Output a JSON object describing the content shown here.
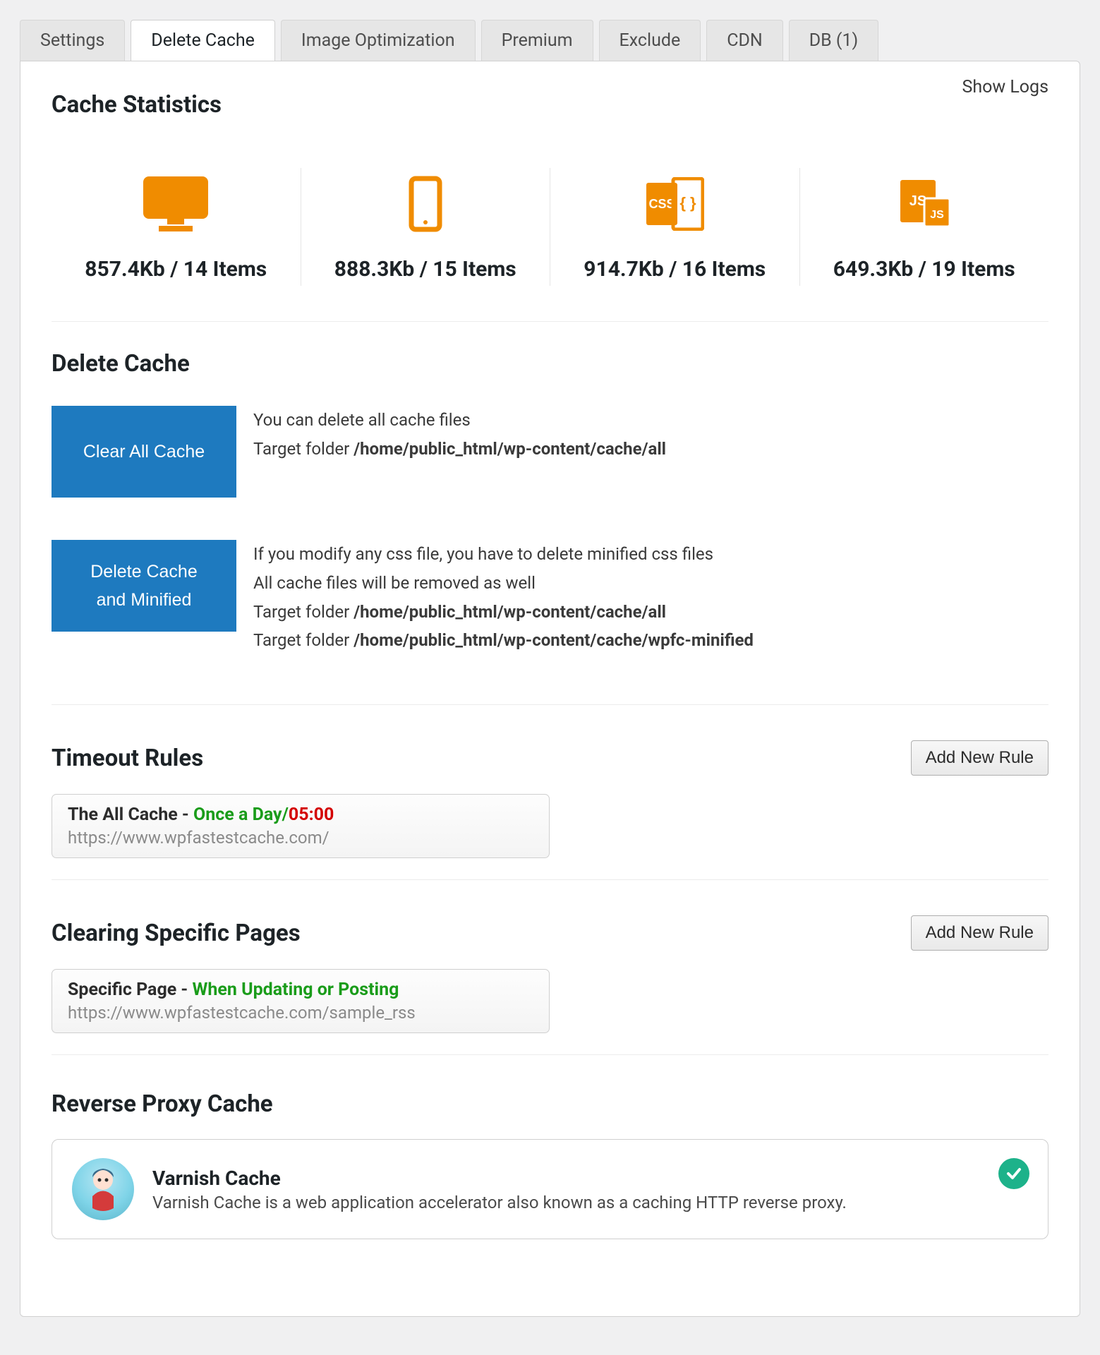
{
  "tabs": [
    {
      "label": "Settings"
    },
    {
      "label": "Delete Cache"
    },
    {
      "label": "Image Optimization"
    },
    {
      "label": "Premium"
    },
    {
      "label": "Exclude"
    },
    {
      "label": "CDN"
    },
    {
      "label": "DB (1)"
    }
  ],
  "active_tab_index": 1,
  "show_logs_label": "Show Logs",
  "sections": {
    "cache_stats_title": "Cache Statistics",
    "delete_cache_title": "Delete Cache",
    "timeout_rules_title": "Timeout Rules",
    "clearing_pages_title": "Clearing Specific Pages",
    "reverse_proxy_title": "Reverse Proxy Cache"
  },
  "stats": [
    {
      "icon": "desktop-icon",
      "value": "857.4Kb / 14 Items"
    },
    {
      "icon": "mobile-icon",
      "value": "888.3Kb / 15 Items"
    },
    {
      "icon": "css-icon",
      "value": "914.7Kb / 16 Items"
    },
    {
      "icon": "js-icon",
      "value": "649.3Kb / 19 Items"
    }
  ],
  "buttons": {
    "clear_all": "Clear All Cache",
    "delete_minified_l1": "Delete Cache",
    "delete_minified_l2": "and Minified",
    "add_new_rule": "Add New Rule"
  },
  "clear_all_desc": {
    "line1": "You can delete all cache files",
    "target_prefix": "Target folder ",
    "path1": "/home/public_html/wp-content/cache/all"
  },
  "delete_minified_desc": {
    "line1": "If you modify any css file, you have to delete minified css files",
    "line2": "All cache files will be removed as well",
    "target_prefix": "Target folder ",
    "path1": "/home/public_html/wp-content/cache/all",
    "path2": "/home/public_html/wp-content/cache/wpfc-minified"
  },
  "timeout_rule": {
    "pre": "The All Cache - ",
    "freq": "Once a Day",
    "sep": "/",
    "time": "05:00",
    "url": "https://www.wpfastestcache.com/"
  },
  "clearing_rule": {
    "pre": "Specific Page - ",
    "cond": "When Updating or Posting",
    "url": "https://www.wpfastestcache.com/sample_rss"
  },
  "proxy": {
    "name": "Varnish Cache",
    "desc": "Varnish Cache is a web application accelerator also known as a caching HTTP reverse proxy."
  }
}
